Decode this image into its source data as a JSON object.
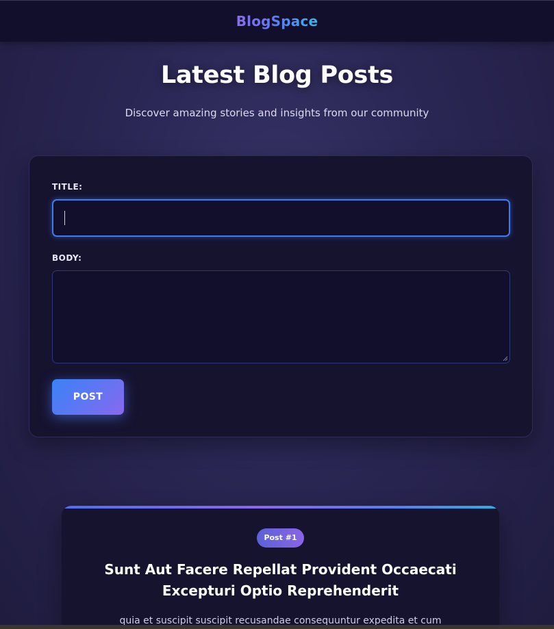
{
  "header": {
    "brand": "BlogSpace"
  },
  "hero": {
    "title": "Latest Blog Posts",
    "subtitle": "Discover amazing stories and insights from our community"
  },
  "form": {
    "title_label": "TITLE:",
    "title_value": "",
    "body_label": "BODY:",
    "body_value": "",
    "submit_label": "POST"
  },
  "posts": [
    {
      "badge": "Post #1",
      "title": "Sunt Aut Facere Repellat Provident Occaecati Excepturi Optio Reprehenderit",
      "body": "quia et suscipit suscipit recusandae consequuntur expedita et cum"
    }
  ],
  "colors": {
    "background": "#2a2755",
    "card": "#16132f",
    "accent_blue": "#3b82f6",
    "accent_purple": "#8a68f0",
    "accent_cyan": "#2ab0e0"
  }
}
